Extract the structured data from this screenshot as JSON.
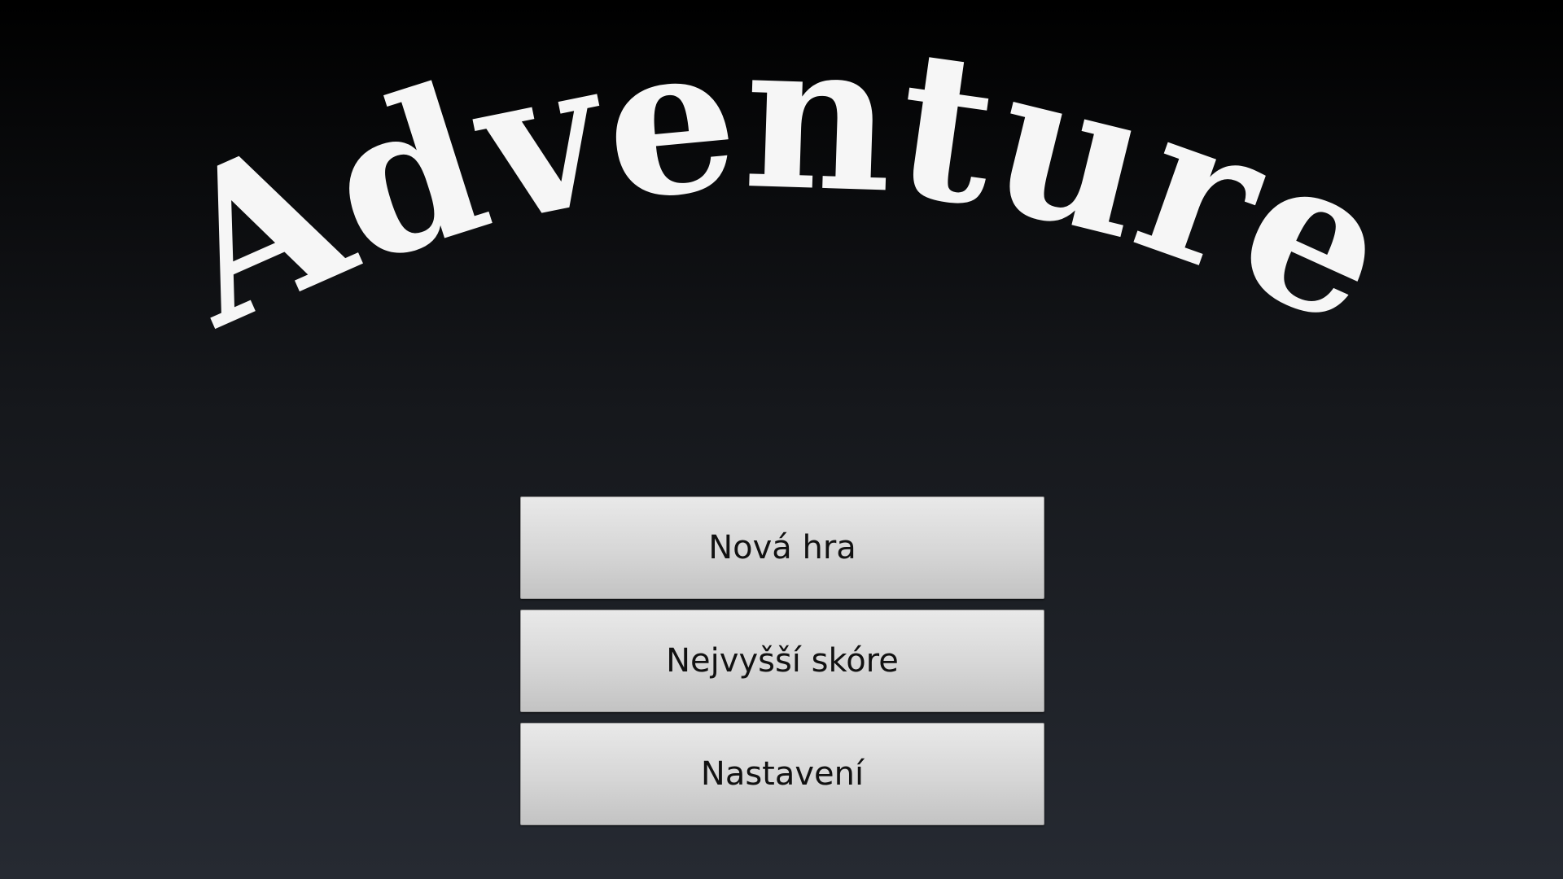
{
  "game": {
    "title": "Adventure"
  },
  "menu": {
    "new_game_label": "Nová hra",
    "high_scores_label": "Nejvyšší skóre",
    "settings_label": "Nastavení"
  },
  "colors": {
    "title_fill": "#f6f6f6",
    "button_bg": "#d6d6d6",
    "button_text": "#111111",
    "background_top": "#000000",
    "background_bottom": "#262a32"
  }
}
